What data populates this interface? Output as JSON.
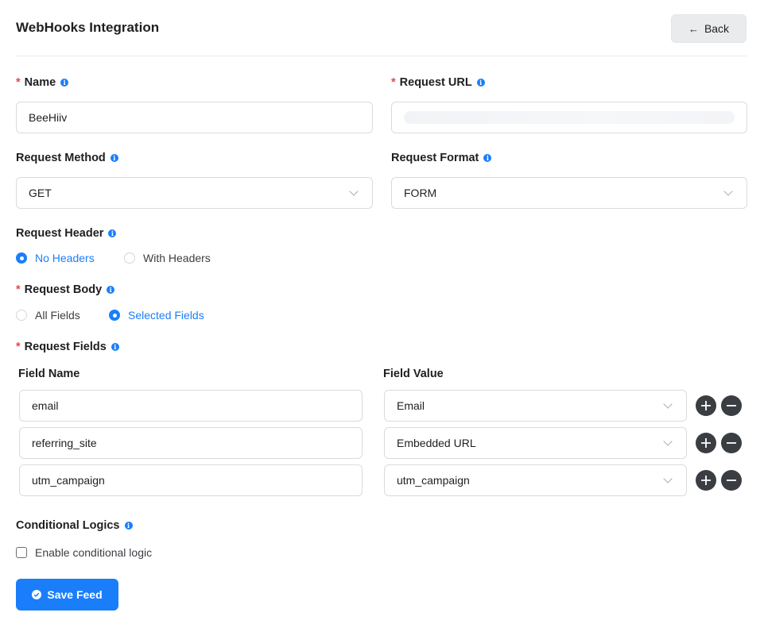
{
  "header": {
    "title": "WebHooks Integration",
    "back_label": "Back"
  },
  "name_field": {
    "label": "Name",
    "value": "BeeHiiv"
  },
  "url_field": {
    "label": "Request URL",
    "value": ""
  },
  "method_field": {
    "label": "Request Method",
    "value": "GET"
  },
  "format_field": {
    "label": "Request Format",
    "value": "FORM"
  },
  "header_section": {
    "label": "Request Header",
    "options": [
      {
        "label": "No Headers",
        "selected": true
      },
      {
        "label": "With Headers",
        "selected": false
      }
    ]
  },
  "body_section": {
    "label": "Request Body",
    "options": [
      {
        "label": "All Fields",
        "selected": false
      },
      {
        "label": "Selected Fields",
        "selected": true
      }
    ]
  },
  "fields_section": {
    "label": "Request Fields",
    "col_name": "Field Name",
    "col_value": "Field Value",
    "rows": [
      {
        "name": "email",
        "value": "Email"
      },
      {
        "name": "referring_site",
        "value": "Embedded URL"
      },
      {
        "name": "utm_campaign",
        "value": "utm_campaign"
      }
    ]
  },
  "conditional": {
    "label": "Conditional Logics",
    "checkbox_label": "Enable conditional logic",
    "checked": false
  },
  "save": {
    "label": "Save Feed"
  },
  "colors": {
    "accent": "#1a7efb",
    "required": "#e5484d",
    "circle_button": "#3a3d41"
  }
}
